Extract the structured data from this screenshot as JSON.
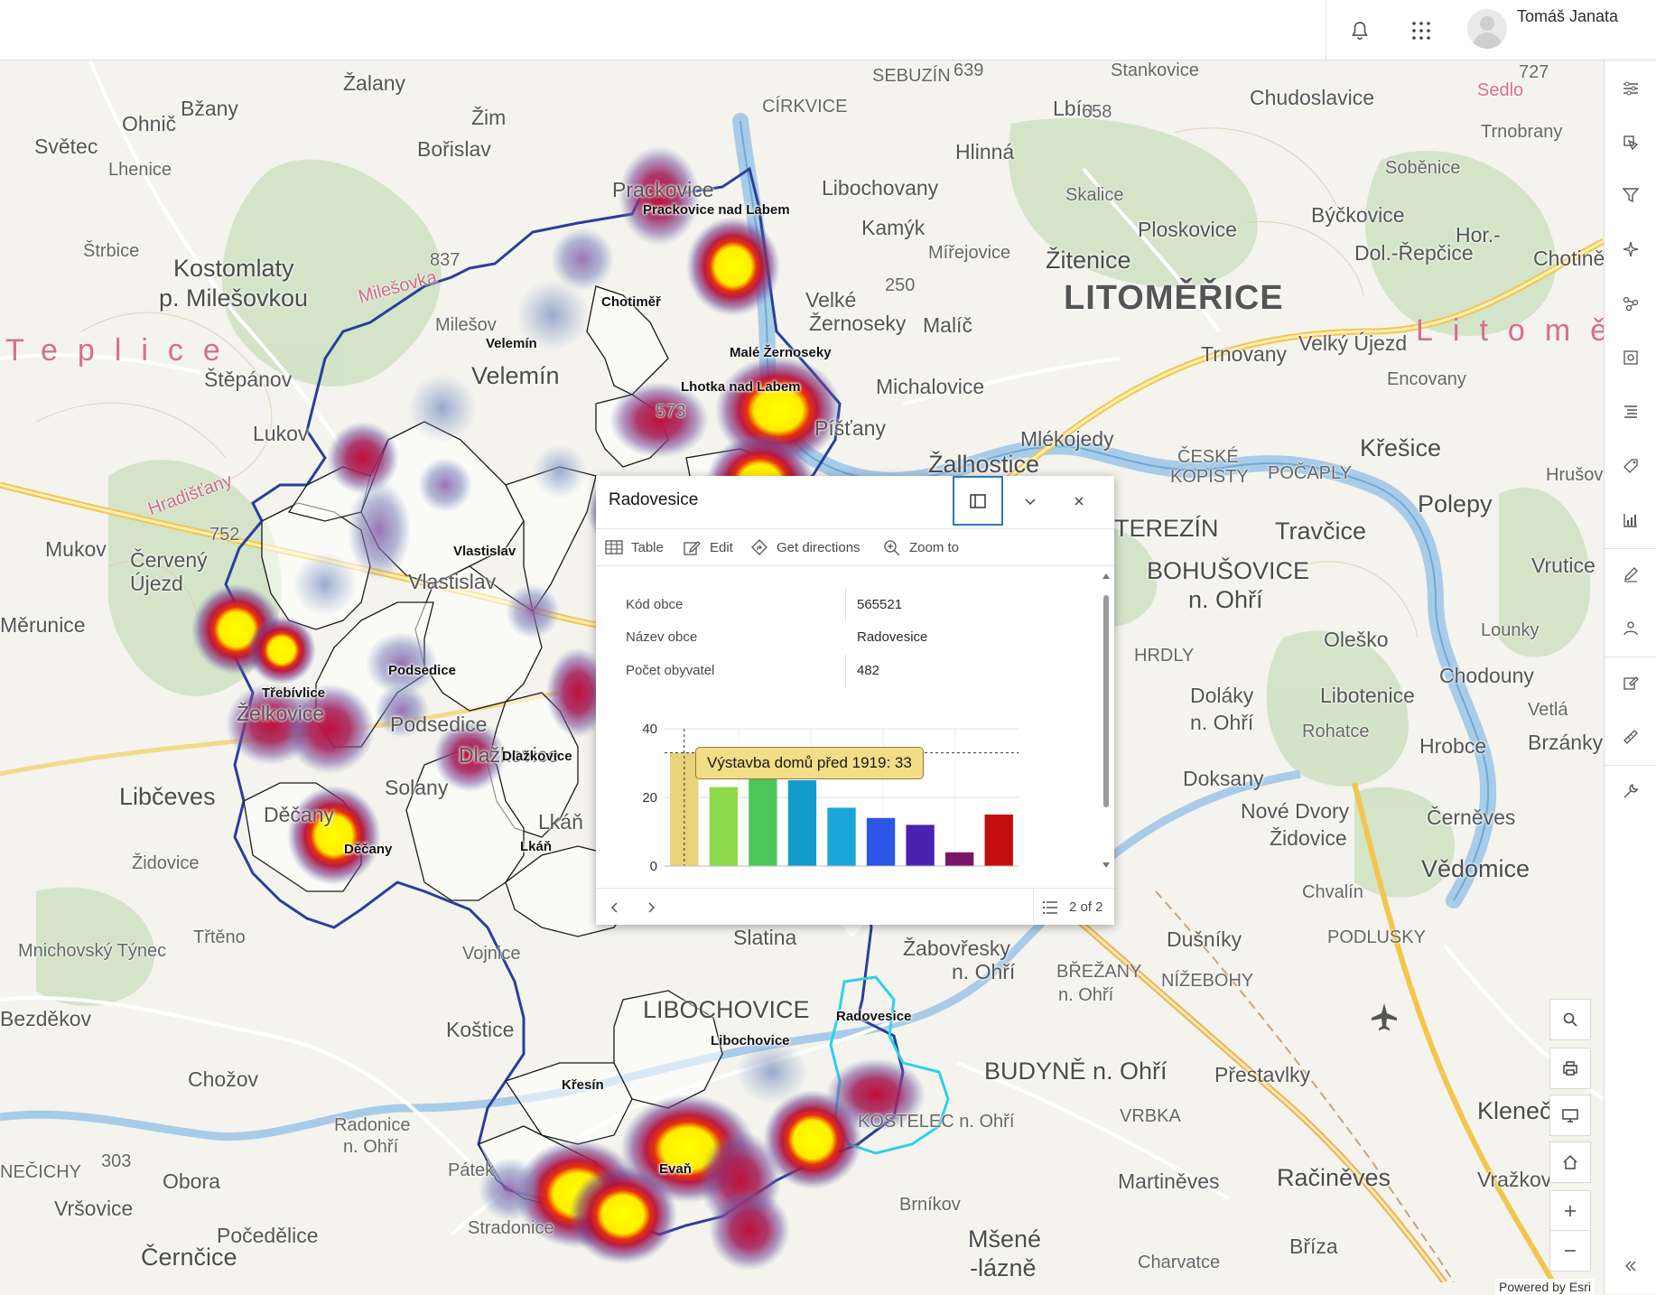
{
  "header": {
    "user_name": "Tomáš Janata",
    "icons": [
      "bell-icon",
      "app-launcher-icon",
      "user-avatar"
    ]
  },
  "map": {
    "attribution": "Powered by Esri",
    "region_label": "Litoměřice",
    "region_label_west": "Teplice",
    "places": {
      "p1": "Žalany",
      "p2": "Bžany",
      "p3": "Ohnič",
      "p4": "Světec",
      "p5": "Lhenice",
      "p6": "Žim",
      "p7": "Bořislav",
      "p8": "Štrbice",
      "p9": "Kostomlaty",
      "p10": "p. Milešovkou",
      "p11": "Štěpánov",
      "p12": "Lukov",
      "p13": "Mukov",
      "p14": "Červený",
      "p15": "Újezd",
      "p16": "Měrunice",
      "p17": "Želkovice",
      "p18": "Libčeves",
      "p19": "Židovice",
      "p20": "Mnichovský Týnec",
      "p21": "Třtěno",
      "p22": "Bezděkov",
      "p23": "Chožov",
      "p24": "Radonice",
      "p25": "n. Ohří",
      "p26": "NEČICHY",
      "p27": "Vršovice",
      "p28": "Obora",
      "p29": "Počedělice",
      "p30": "Černčice",
      "p31": "Pátek",
      "p32": "Stradonice",
      "p33": "Koštice",
      "p34": "Vojnice",
      "p35": "LIBOCHOVICE",
      "p36": "Slatina",
      "p37": "Žabovřesky",
      "p38": "n. Ohří",
      "p39": "BŘEŽANY",
      "p40": "n. Ohří",
      "p41": "BUDYNĚ n. Ohří",
      "p42": "KOSTELEC n. Ohří",
      "p43": "VRBKA",
      "p44": "Přestavlky",
      "p45": "NÍŽEBOHY",
      "p46": "Dušníky",
      "p47": "PODLUSKY",
      "p48": "Martiněves",
      "p49": "Račiněves",
      "p50": "Vražkov",
      "p51": "Kleneč",
      "p52": "Brníkov",
      "p53": "Mšené",
      "p54": "-lázně",
      "p55": "Charvatce",
      "p56": "Bříza",
      "p57": "Chvalín",
      "p58": "Vědomice",
      "p59": "Černěves",
      "p60": "Nové Dvory",
      "p61": "Židovice",
      "p62": "Doksany",
      "p63": "Doláky",
      "p64": "n. Ohří",
      "p65": "Rohatce",
      "p66": "Hrobce",
      "p67": "Libotenice",
      "p68": "Oleško",
      "p69": "Chodouny",
      "p70": "Lounky",
      "p71": "Brzánky",
      "p72": "Vetlá",
      "p73": "BOHUŠOVICE",
      "p74": "n. Ohří",
      "p75": "TEREZÍN",
      "p76": "Travčice",
      "p77": "HRDLY",
      "p78": "ČESKÉ",
      "p79": "KOPISTY",
      "p80": "POČAPLY",
      "p81": "Mlékojedy",
      "p82": "Žalhostice",
      "p83": "Polepy",
      "p84": "Křešice",
      "p85": "Vrutice",
      "p86": "LITOMĚŘICE",
      "p87": "Žitenice",
      "p88": "Trnovany",
      "p89": "Velký Újezd",
      "p90": "Encovany",
      "p91": "Michalovice",
      "p92": "Píšťany",
      "p93": "Malíč",
      "p94": "Mířejovice",
      "p95": "Kamýk",
      "p96": "Libochovany",
      "p97": "Hlinná",
      "p98": "Skalice",
      "p99": "Ploskovice",
      "p100": "Býčkovice",
      "p101": "Soběnice",
      "p102": "Trnobrany",
      "p103": "Chudoslavice",
      "p104": "Stankovice",
      "p105": "Lbín",
      "p106": "SEBUZÍN",
      "p107": "CÍRKVICE",
      "p108": "Sedlo",
      "p109": "Velemín",
      "p110": "Milešov",
      "p111": "Dlažkovice",
      "p112": "Podsedice",
      "p113": "Děčany",
      "p114": "Solany",
      "p115": "Lkáň",
      "p116": "Prackovice",
      "p117": "Velké",
      "p118": "Žernoseky",
      "p119": "Vlastislav",
      "p120": "Hradišťany",
      "p121": "Milešovka",
      "p122": "Chotiněves",
      "p123": "Hrušov",
      "p124": "Dol.-Řepčice",
      "p125": "Hor.-"
    },
    "municipalities": {
      "m1": "Prackovice nad Labem",
      "m2": "Chotiměř",
      "m3": "Velemín",
      "m4": "Malé Žernoseky",
      "m5": "Lhotka nad Labem",
      "m6": "Vlastislav",
      "m7": "Podsedice",
      "m8": "Třebívlice",
      "m9": "Dlažkovice",
      "m10": "Lkáň",
      "m11": "Děčany",
      "m12": "Radovesice",
      "m13": "Libochovice",
      "m14": "Křesín",
      "m15": "Evaň"
    },
    "elevations": {
      "e1": "639",
      "e2": "658",
      "e3": "727",
      "e4": "837",
      "e5": "573",
      "e6": "250",
      "e7": "303",
      "e8": "752"
    }
  },
  "popup": {
    "title": "Radovesice",
    "actions": [
      {
        "label": "Table",
        "icon": "table-icon"
      },
      {
        "label": "Edit",
        "icon": "edit-icon"
      },
      {
        "label": "Get directions",
        "icon": "directions-icon"
      },
      {
        "label": "Zoom to",
        "icon": "zoom-to-icon"
      }
    ],
    "fields": [
      {
        "key": "Kód obce",
        "value": "565521"
      },
      {
        "key": "Název obce",
        "value": "Radovesice"
      },
      {
        "key": "Počet obyvatel",
        "value": "482"
      }
    ],
    "tooltip": "Výstavba domů před 1919: 33",
    "pager": "2 of 2",
    "colors": {
      "dock_border": "#2a7ab7",
      "tooltip_bg": "#f3dd87"
    }
  },
  "chart_data": {
    "type": "bar",
    "yticks": [
      "0",
      "20",
      "40"
    ],
    "ylim": [
      0,
      40
    ],
    "grid": true,
    "legend": "none",
    "values": [
      33,
      23,
      27,
      25,
      17,
      14,
      12,
      4,
      15
    ],
    "colors": [
      "#e8d27a",
      "#8ddb4a",
      "#4cc85a",
      "#129ccc",
      "#1aa6d8",
      "#2a55e6",
      "#4a22b0",
      "#7a1466",
      "#c40d0d"
    ],
    "highlight_index": 0,
    "reference_value": 33
  },
  "toolbar": {
    "icons": [
      "layers-settings-icon",
      "basemap-icon",
      "filter-icon",
      "sketch-icon",
      "analysis-icon",
      "settings-icon",
      "legend-icon",
      "tag-icon",
      "chart-icon",
      "draw-icon",
      "people-icon",
      "edit-icon",
      "measure-icon",
      "wrench-icon",
      "collapse-icon"
    ]
  },
  "widgets": [
    "search-icon",
    "print-icon",
    "fullscreen-icon",
    "home-icon",
    "zoom-in-icon",
    "zoom-out-icon"
  ]
}
